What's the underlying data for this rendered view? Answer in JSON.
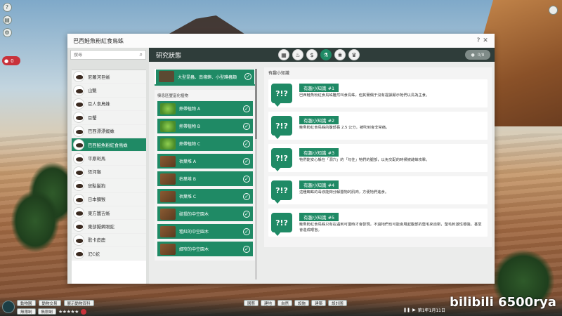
{
  "dialog": {
    "title": "巴西鮭魚粉紅食鳥蛛",
    "help_label": "?",
    "close_label": "✕"
  },
  "search": {
    "placeholder": "搜尋"
  },
  "species": [
    {
      "label": "尼羅河巨蜥"
    },
    {
      "label": "山魈"
    },
    {
      "label": "巨人食鳥蛛"
    },
    {
      "label": "巨蟹"
    },
    {
      "label": "巴西漂漂蜘蛛"
    },
    {
      "label": "巴西鮭魚粉紅食鳥蛛",
      "selected": true
    },
    {
      "label": "平原斑馬"
    },
    {
      "label": "恆河猴"
    },
    {
      "label": "斑點鬣狗"
    },
    {
      "label": "日本獼猴"
    },
    {
      "label": "東方蠶吉蜥"
    },
    {
      "label": "東部擬蝎眼蛇"
    },
    {
      "label": "歌卡皮鹿"
    },
    {
      "label": "氾C蛇"
    }
  ],
  "research": {
    "title": "研究狀態",
    "badge_value": "0/8",
    "top_item": {
      "label": "大型昆蟲、南壤蟀、小型蹲蟲類"
    },
    "section_label": "棲息區豐富化植物",
    "items": [
      {
        "label": "熱帶植物 A",
        "kind": "green"
      },
      {
        "label": "熱帶植物 B",
        "kind": "green"
      },
      {
        "label": "熱帶植物 C",
        "kind": "green"
      },
      {
        "label": "枯葉堆 A",
        "kind": "wood"
      },
      {
        "label": "枯葉堆 B",
        "kind": "wood"
      },
      {
        "label": "枯葉堆 C",
        "kind": "wood"
      },
      {
        "label": "破損的中空園木",
        "kind": "wood"
      },
      {
        "label": "粗紅的中空園木",
        "kind": "wood"
      },
      {
        "label": "細窄的中空園木",
        "kind": "wood"
      }
    ]
  },
  "facts": {
    "title": "有趣小知識",
    "items": [
      {
        "tag": "有趣小知識 #1",
        "text": "巴西鮭魚粉紅食鳥蛛雖然叫食鳥蛛，但其實偶于沒有證據顯示牠們以鳥為主食。"
      },
      {
        "tag": "有趣小知識 #2",
        "text": "鮭魚粉紅食鳥蛛的腹部長 2.5 公分，被吹到會非常痛。"
      },
      {
        "tag": "有趣小知識 #3",
        "text": "牠們能安心躲在「洞穴」的「勾住」牠們的腿部，以免交配的時候被雌蛛攻擊。"
      },
      {
        "tag": "有趣小知識 #4",
        "text": "這種蜘蛛的毒液能夠分解獵物的肌肉，方便牠們進食。"
      },
      {
        "tag": "有趣小知識 #5",
        "text": "鮭魚粉紅食鳥蛛只有在遇到可還時才會發現，不過牠們也可能會甩起腹部的螫毛來自衛，螫毛刺激性極強，甚至會造成眼盲。"
      }
    ]
  },
  "bottom": {
    "left_buttons": [
      "動物園",
      "動物交易",
      "展示動物百科"
    ],
    "mode_buttons": [
      "無限制",
      "無限制"
    ],
    "center_buttons": [
      "園藝",
      "建地",
      "自然",
      "設施",
      "建築",
      "設計圖"
    ],
    "date": "第1年1月11日"
  },
  "watermark": "bilibili 6500rya",
  "colors": {
    "accent": "#1f8a65",
    "header": "#2f3d3a",
    "alert": "#c8323b"
  },
  "icons": [
    "help-icon",
    "close-icon",
    "search-icon",
    "check-icon",
    "fact-bubble-icon"
  ]
}
